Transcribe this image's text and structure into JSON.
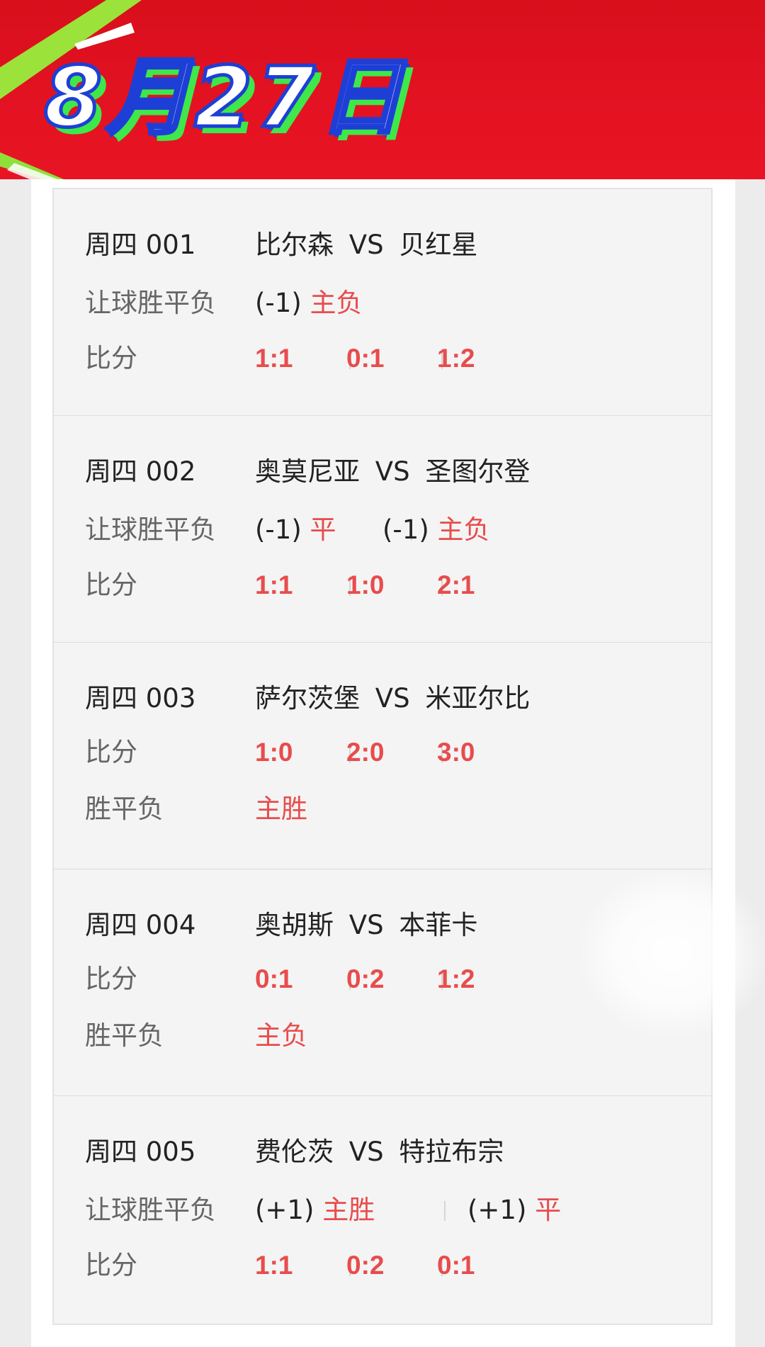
{
  "header": {
    "date": "8月27日"
  },
  "matches": [
    {
      "code": "周四 001",
      "teams": {
        "home": "比尔森",
        "vs": "VS",
        "away": "贝红星"
      },
      "rows": [
        {
          "label": "让球胜平负",
          "handicap": [
            "(-1)"
          ],
          "picks": [
            "主负"
          ]
        },
        {
          "label": "比分",
          "scores": [
            "1:1",
            "0:1",
            "1:2"
          ]
        }
      ]
    },
    {
      "code": "周四 002",
      "teams": {
        "home": "奥莫尼亚",
        "vs": "VS",
        "away": "圣图尔登"
      },
      "rows": [
        {
          "label": "让球胜平负",
          "handicap": [
            "(-1)",
            "(-1)"
          ],
          "picks": [
            "平",
            "主负"
          ]
        },
        {
          "label": "比分",
          "scores": [
            "1:1",
            "1:0",
            "2:1"
          ]
        }
      ]
    },
    {
      "code": "周四 003",
      "teams": {
        "home": "萨尔茨堡",
        "vs": "VS",
        "away": "米亚尔比"
      },
      "rows": [
        {
          "label": "比分",
          "scores": [
            "1:0",
            "2:0",
            "3:0"
          ]
        },
        {
          "label": "胜平负",
          "picks": [
            "主胜"
          ]
        }
      ]
    },
    {
      "code": "周四 004",
      "teams": {
        "home": "奥胡斯",
        "vs": "VS",
        "away": "本菲卡"
      },
      "rows": [
        {
          "label": "比分",
          "scores": [
            "0:1",
            "0:2",
            "1:2"
          ]
        },
        {
          "label": "胜平负",
          "picks": [
            "主负"
          ]
        }
      ]
    },
    {
      "code": "周四 005",
      "teams": {
        "home": "费伦茨",
        "vs": "VS",
        "away": "特拉布宗"
      },
      "rows": [
        {
          "label": "让球胜平负",
          "handicap": [
            "(+1)",
            "(+1)"
          ],
          "picks": [
            "主胜",
            "平"
          ]
        },
        {
          "label": "比分",
          "scores": [
            "1:1",
            "0:2",
            "0:1"
          ]
        }
      ]
    }
  ],
  "colors": {
    "banner_red": "#e41222",
    "pick_red": "#e84c4c",
    "title_blue": "#1e3fd6",
    "title_green": "#3ee84a"
  }
}
